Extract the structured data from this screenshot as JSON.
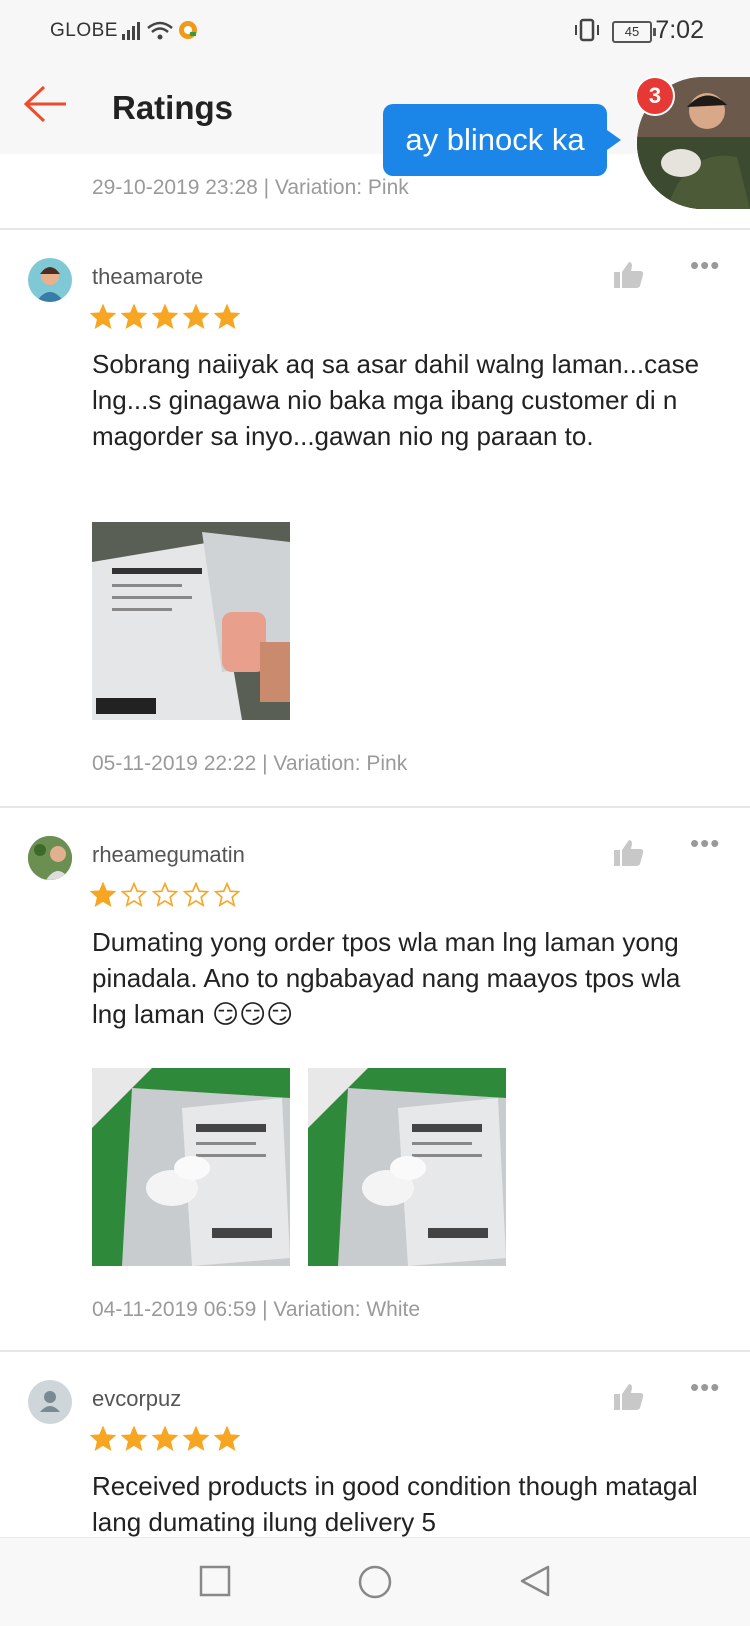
{
  "status_bar": {
    "carrier": "GLOBE",
    "battery": "45",
    "time": "7:02"
  },
  "header": {
    "title": "Ratings"
  },
  "previous_review_meta": "29-10-2019 23:28 | Variation: Pink",
  "chat_bubble": {
    "text": "ay blinock ka",
    "badge_count": "3"
  },
  "reviews": [
    {
      "username": "theamarote",
      "rating": 5,
      "text": "Sobrang naiiyak aq sa asar dahil walng laman...case lng...s ginagawa nio baka mga ibang customer di n magorder sa inyo...gawan nio ng paraan to.",
      "meta": "05-11-2019 22:22 | Variation: Pink"
    },
    {
      "username": "rheamegumatin",
      "rating": 1,
      "text": "Dumating yong order tpos wla man lng laman yong pinadala.  Ano to ngbabayad nang maayos tpos wla lng laman 😏😏😏",
      "meta": "04-11-2019 06:59 | Variation: White"
    },
    {
      "username": "evcorpuz",
      "rating": 5,
      "text": "Received products in good condition though matagal lang dumating ilung delivery   5",
      "meta": ""
    }
  ],
  "colors": {
    "accent": "#ee4d2d",
    "star": "#f6a623",
    "bubble": "#1c86e8",
    "badge": "#e63935"
  },
  "icons": [
    "back-arrow-icon",
    "thumbs-up-icon",
    "more-options-icon",
    "star-icon",
    "nav-recents-icon",
    "nav-home-icon",
    "nav-back-icon"
  ]
}
